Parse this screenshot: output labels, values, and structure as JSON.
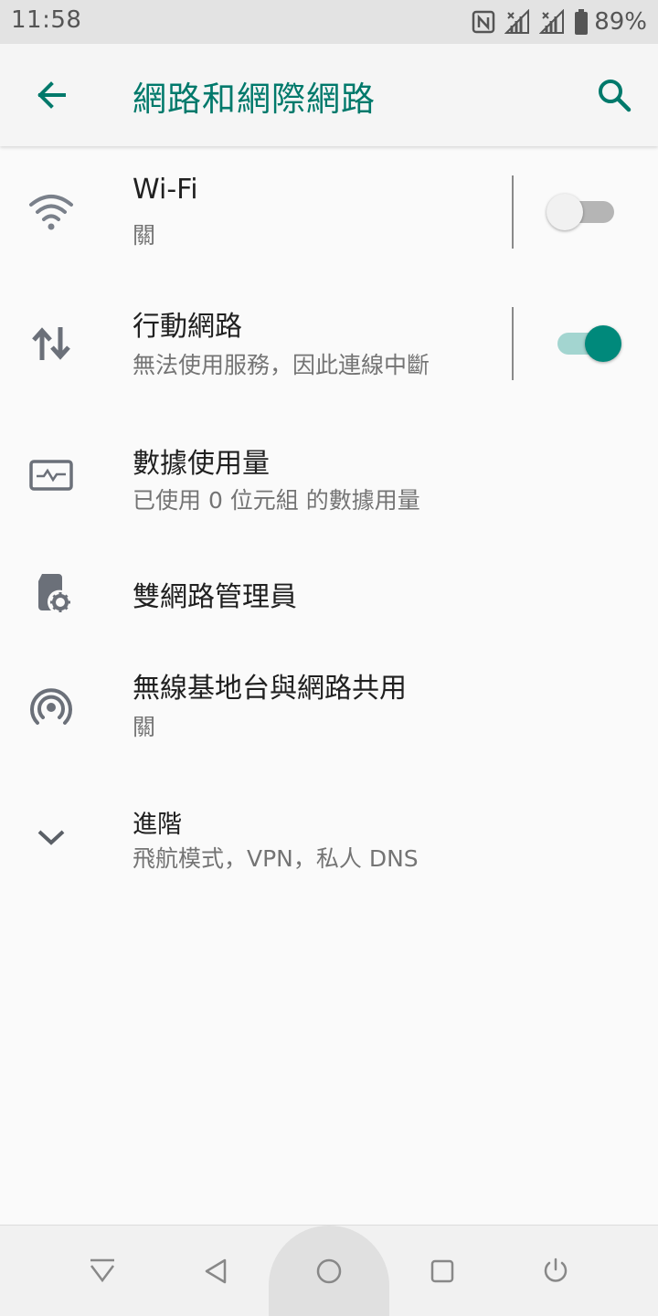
{
  "status_bar": {
    "time": "11:58",
    "battery_percent": "89%",
    "icons": [
      "nfc-icon",
      "signal-sim1-icon",
      "signal-sim2-icon",
      "battery-icon"
    ]
  },
  "app_bar": {
    "title": "網路和網際網路",
    "back_icon": "arrow-left-icon",
    "search_icon": "search-icon",
    "accent_color": "#00796b"
  },
  "settings": [
    {
      "title": "Wi-Fi",
      "subtitle": "關",
      "icon": "wifi-icon",
      "toggle": "off"
    },
    {
      "title": "行動網路",
      "subtitle": "無法使用服務，因此連線中斷",
      "icon": "mobile-data-arrows-icon",
      "toggle": "on"
    },
    {
      "title": "數據使用量",
      "subtitle": "已使用 0 位元組 的數據用量",
      "icon": "data-usage-icon"
    },
    {
      "title": "雙網路管理員",
      "subtitle": "",
      "icon": "sim-settings-icon"
    },
    {
      "title": "無線基地台與網路共用",
      "subtitle": "關",
      "icon": "hotspot-icon"
    },
    {
      "title": "進階",
      "subtitle": "飛航模式，VPN，私人 DNS",
      "icon": "chevron-down-icon"
    }
  ],
  "nav_bar": {
    "buttons": [
      "notification-pull-icon",
      "back-triangle-icon",
      "home-circle-icon",
      "recents-square-icon",
      "power-icon"
    ]
  }
}
